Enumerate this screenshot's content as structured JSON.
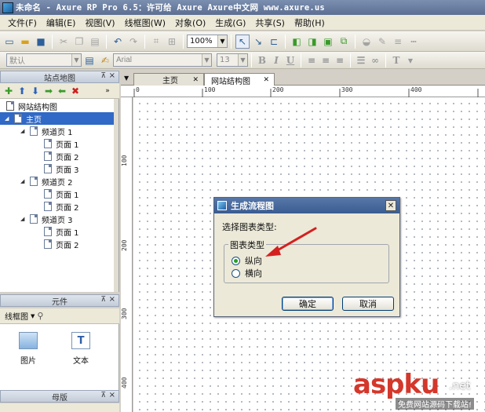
{
  "window": {
    "title": "未命名 - Axure RP Pro 6.5：许可给 Axure Axure中文网 www.axure.us"
  },
  "menu": [
    "文件(F)",
    "编辑(E)",
    "视图(V)",
    "线框图(W)",
    "对象(O)",
    "生成(G)",
    "共享(S)",
    "帮助(H)"
  ],
  "toolbar": {
    "zoom": "100%"
  },
  "format_toolbar": {
    "style": "默认",
    "font": "Arial",
    "size": "13"
  },
  "sitemap": {
    "title": "站点地图",
    "root": "网站结构图",
    "items": [
      {
        "label": "主页",
        "level": 0,
        "selected": true
      },
      {
        "label": "频道页 1",
        "level": 1
      },
      {
        "label": "页面 1",
        "level": 2
      },
      {
        "label": "页面 2",
        "level": 2
      },
      {
        "label": "页面 3",
        "level": 2
      },
      {
        "label": "频道页 2",
        "level": 1
      },
      {
        "label": "页面 1",
        "level": 2
      },
      {
        "label": "页面 2",
        "level": 2
      },
      {
        "label": "频道页 3",
        "level": 1
      },
      {
        "label": "页面 1",
        "level": 2
      },
      {
        "label": "页面 2",
        "level": 2
      }
    ]
  },
  "widgets": {
    "title": "元件",
    "library": "线框图",
    "items": [
      "图片",
      "文本"
    ]
  },
  "masters": {
    "title": "母版"
  },
  "tabs": [
    "主页",
    "网站结构图"
  ],
  "ruler": {
    "top": [
      "0",
      "100",
      "200",
      "300",
      "400"
    ],
    "left": [
      "100",
      "200",
      "300",
      "400"
    ]
  },
  "dialog": {
    "title": "生成流程图",
    "prompt": "选择图表类型:",
    "group": "图表类型",
    "options": [
      "纵向",
      "横向"
    ],
    "selected": "纵向",
    "ok": "确定",
    "cancel": "取消"
  },
  "watermark": {
    "brand": "aspku",
    "tld": ".net",
    "tagline": "免费网站源码下载站!"
  }
}
